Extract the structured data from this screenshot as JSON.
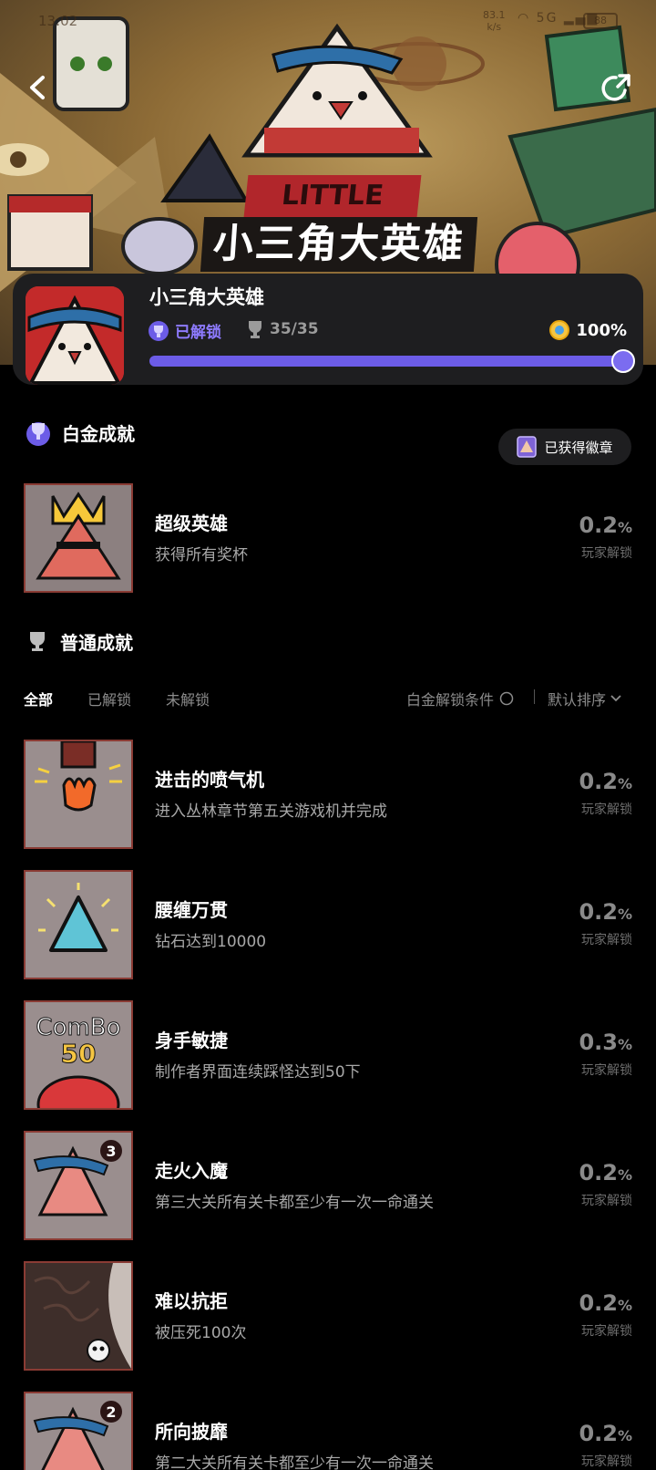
{
  "status_bar": {
    "time": "13:02",
    "net_speed": "83.1",
    "net_unit": "k/s",
    "signal": "5G",
    "battery": "88"
  },
  "banner": {
    "title_top": "LITTLE",
    "title": "小三角大英雄"
  },
  "game": {
    "name": "小三角大英雄",
    "unlock_status": "已解锁",
    "trophy_count": "35/35",
    "completion": "100%",
    "progress": 1.0
  },
  "platinum": {
    "heading": "白金成就",
    "badge_button": "已获得徽章",
    "item": {
      "title": "超级英雄",
      "desc": "获得所有奖杯",
      "pct": "0.2",
      "pct_unit": "%",
      "sub": "玩家解锁"
    }
  },
  "normal": {
    "heading": "普通成就",
    "tabs": [
      "全部",
      "已解锁",
      "未解锁"
    ],
    "condition_label": "白金解锁条件",
    "sort_label": "默认排序",
    "items": [
      {
        "title": "进击的喷气机",
        "desc": "进入丛林章节第五关游戏机并完成",
        "pct": "0.2",
        "pct_unit": "%",
        "sub": "玩家解锁"
      },
      {
        "title": "腰缠万贯",
        "desc": "钻石达到10000",
        "pct": "0.2",
        "pct_unit": "%",
        "sub": "玩家解锁"
      },
      {
        "title": "身手敏捷",
        "desc": "制作者界面连续踩怪达到50下",
        "pct": "0.3",
        "pct_unit": "%",
        "sub": "玩家解锁",
        "thumb_text": "ComBo",
        "thumb_num": "50"
      },
      {
        "title": "走火入魔",
        "desc": "第三大关所有关卡都至少有一次一命通关",
        "pct": "0.2",
        "pct_unit": "%",
        "sub": "玩家解锁",
        "thumb_num": "3"
      },
      {
        "title": "难以抗拒",
        "desc": "被压死100次",
        "pct": "0.2",
        "pct_unit": "%",
        "sub": "玩家解锁"
      },
      {
        "title": "所向披靡",
        "desc": "第二大关所有关卡都至少有一次一命通关",
        "pct": "0.2",
        "pct_unit": "%",
        "sub": "玩家解锁",
        "thumb_num": "2"
      }
    ]
  },
  "colors": {
    "accent": "#6c5ce7",
    "card": "#1e1e20",
    "thumb_border": "#8a3b34"
  }
}
